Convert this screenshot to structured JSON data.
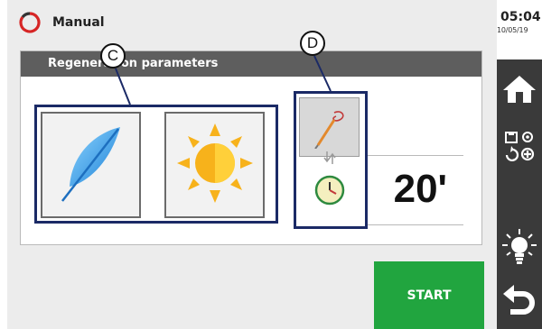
{
  "header": {
    "mode_label": "Manual"
  },
  "status": {
    "time": "05:04",
    "date": "10/05/19"
  },
  "panel": {
    "title": "Regeneration parameters"
  },
  "callouts": {
    "c": "C",
    "d": "D"
  },
  "selection": {
    "value": "20'"
  },
  "actions": {
    "start_label": "START"
  },
  "sidebar": {
    "icons": [
      "home-icon",
      "program-settings-icon",
      "light-icon",
      "back-icon"
    ]
  },
  "colors": {
    "start_green": "#21a53f",
    "title_bar": "#5e5e5e",
    "highlight": "#1b2a66",
    "sidebar_bg": "#3a3a3a"
  }
}
